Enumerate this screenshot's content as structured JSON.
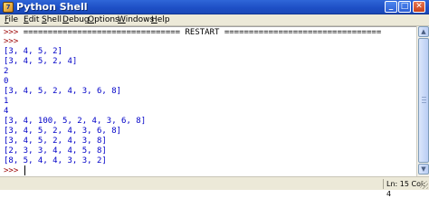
{
  "window": {
    "title": "Python Shell",
    "icon": "python-icon",
    "controls": {
      "minimize": "_",
      "maximize": "□",
      "close": "✕"
    }
  },
  "menu": {
    "items": [
      {
        "label": "File",
        "u": "F",
        "rest": "ile"
      },
      {
        "label": "Edit",
        "u": "E",
        "rest": "dit"
      },
      {
        "label": "Shell",
        "u": "S",
        "rest": "hell"
      },
      {
        "label": "Debug",
        "u": "D",
        "rest": "ebug"
      },
      {
        "label": "Options",
        "u": "O",
        "rest": "ptions"
      },
      {
        "label": "Windows",
        "u": "W",
        "rest": "indows"
      },
      {
        "label": "Help",
        "u": "H",
        "rest": "elp"
      }
    ]
  },
  "shell": {
    "prompt": ">>>",
    "restart_line": "================================ RESTART ================================",
    "output": [
      "[3, 4, 5, 2]",
      "[3, 4, 5, 2, 4]",
      "2",
      "0",
      "[3, 4, 5, 2, 4, 3, 6, 8]",
      "1",
      "4",
      "[3, 4, 100, 5, 2, 4, 3, 6, 8]",
      "[3, 4, 5, 2, 4, 3, 6, 8]",
      "[3, 4, 5, 2, 4, 3, 8]",
      "[2, 3, 3, 4, 4, 5, 8]",
      "[8, 5, 4, 4, 3, 3, 2]"
    ],
    "colors": {
      "prompt": "#9b0000",
      "output": "#0000c8"
    }
  },
  "status": {
    "position": "Ln: 15 Col: 4"
  }
}
